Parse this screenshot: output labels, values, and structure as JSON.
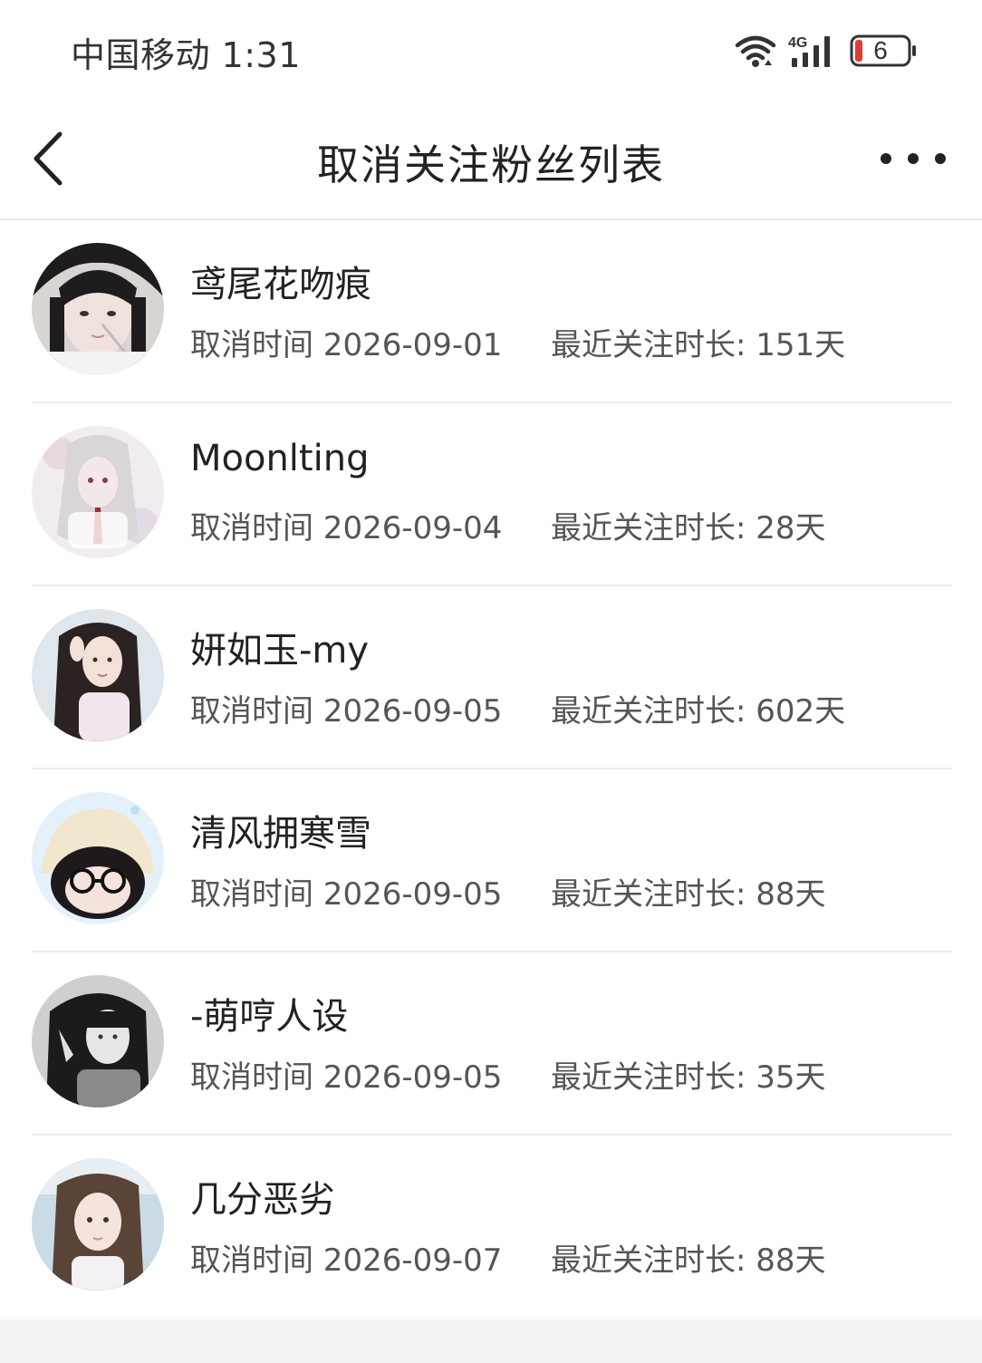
{
  "status_bar": {
    "carrier_time": "中国移动 1:31",
    "network": "4G",
    "battery_level": "6",
    "icons": [
      "wifi-icon",
      "signal-icon",
      "battery-icon"
    ]
  },
  "nav": {
    "title": "取消关注粉丝列表",
    "back_icon": "chevron-left-icon",
    "more_icon": "more-dots-icon"
  },
  "colors": {
    "text_primary": "#222222",
    "text_secondary": "#555555",
    "divider": "#ececec",
    "battery_low": "#e53935",
    "page_bg": "#ffffff",
    "footer_bg": "#f2f2f2"
  },
  "fans": [
    {
      "nickname": "鸢尾花吻痕",
      "cancel_time": "取消时间 2026-09-01",
      "follow_duration": "最近关注时长: 151天"
    },
    {
      "nickname": "Moonlting",
      "cancel_time": "取消时间 2026-09-04",
      "follow_duration": "最近关注时长: 28天"
    },
    {
      "nickname": "妍如玉-my",
      "cancel_time": "取消时间 2026-09-05",
      "follow_duration": "最近关注时长: 602天"
    },
    {
      "nickname": "清风拥寒雪",
      "cancel_time": "取消时间 2026-09-05",
      "follow_duration": "最近关注时长: 88天"
    },
    {
      "nickname": "-萌哼人设",
      "cancel_time": "取消时间 2026-09-05",
      "follow_duration": "最近关注时长: 35天"
    },
    {
      "nickname": "几分恶劣",
      "cancel_time": "取消时间 2026-09-07",
      "follow_duration": "最近关注时长: 88天"
    }
  ]
}
